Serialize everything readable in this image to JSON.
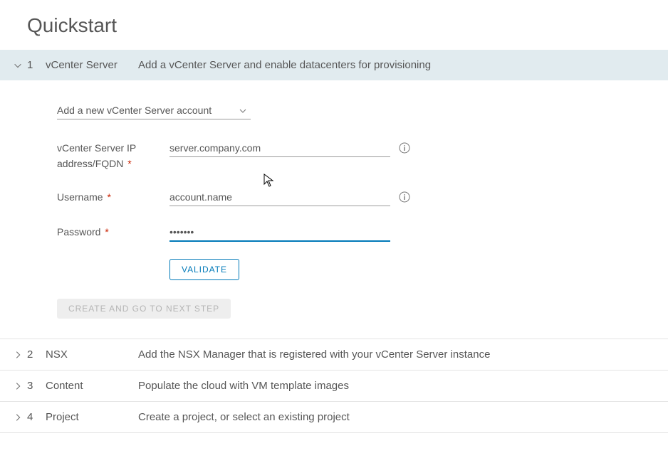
{
  "page": {
    "title": "Quickstart"
  },
  "steps": [
    {
      "num": "1",
      "label": "vCenter Server",
      "desc": "Add a vCenter Server and enable datacenters for provisioning"
    },
    {
      "num": "2",
      "label": "NSX",
      "desc": "Add the NSX Manager that is registered with your vCenter Server instance"
    },
    {
      "num": "3",
      "label": "Content",
      "desc": "Populate the cloud with VM template images"
    },
    {
      "num": "4",
      "label": "Project",
      "desc": "Create a project, or select an existing project"
    }
  ],
  "form": {
    "account_select": "Add a new vCenter Server account",
    "fields": {
      "server": {
        "label": "vCenter Server IP address/FQDN",
        "value": "server.company.com"
      },
      "username": {
        "label": "Username",
        "value": "account.name"
      },
      "password": {
        "label": "Password",
        "value": "•••••••"
      }
    },
    "buttons": {
      "validate": "VALIDATE",
      "create": "CREATE AND GO TO NEXT STEP"
    }
  }
}
